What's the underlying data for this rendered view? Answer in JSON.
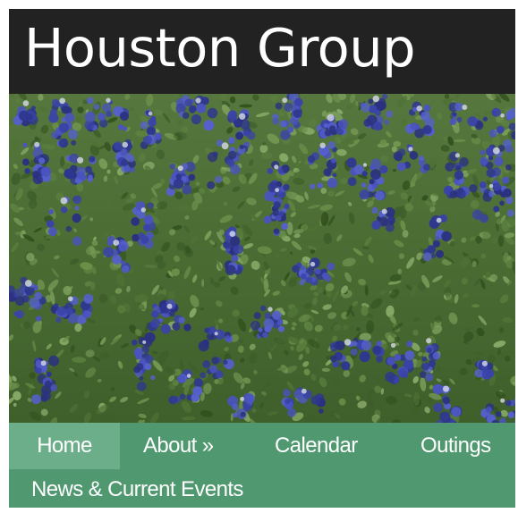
{
  "site": {
    "title": "Houston Group"
  },
  "hero": {
    "image_subject": "bluebonnet-flower-field"
  },
  "nav": {
    "items": [
      {
        "label": "Home",
        "active": true
      },
      {
        "label": "About »",
        "active": false
      },
      {
        "label": "Calendar",
        "active": false
      },
      {
        "label": "Outings",
        "active": false
      },
      {
        "label": "News & Current Events",
        "active": false
      }
    ]
  },
  "colors": {
    "header_bg": "#222222",
    "nav_bg": "#4f9870",
    "nav_active_bg": "#6cae8a",
    "text": "#ffffff",
    "foliage": "#4c6e34",
    "flower": "#3a43a8"
  }
}
